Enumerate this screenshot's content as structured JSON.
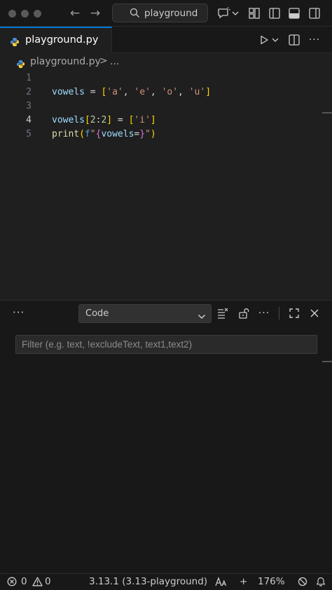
{
  "titlebar": {
    "search_text": "playground"
  },
  "tab": {
    "label": "playground.py"
  },
  "breadcrumb": {
    "file": "playground.py",
    "separator": ">",
    "more": "..."
  },
  "editor": {
    "line_numbers": [
      "1",
      "2",
      "3",
      "4",
      "5"
    ],
    "active_line": "4"
  },
  "panel": {
    "more_label": "···",
    "select_value": "Code",
    "filter_placeholder": "Filter (e.g. text, !excludeText, text1,text2)"
  },
  "statusbar": {
    "errors": "0",
    "warnings": "0",
    "interpreter": "3.13.1 (3.13-playground)",
    "plus": "+",
    "zoom": "176%"
  },
  "colors": {
    "accent": "#0078d4",
    "variable": "#9cdcfe",
    "string": "#ce9178",
    "function": "#dcdcaa",
    "bracket": "#ffd700"
  }
}
